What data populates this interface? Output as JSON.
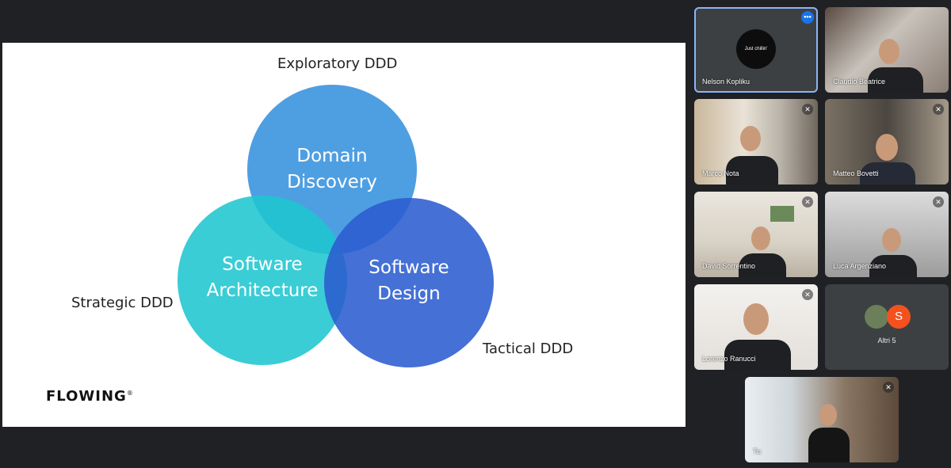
{
  "slide": {
    "top_label": "Exploratory DDD",
    "left_label": "Strategic DDD",
    "right_label": "Tactical DDD",
    "circles": [
      {
        "line1": "Domain",
        "line2": "Discovery",
        "color": "#3f97e0"
      },
      {
        "line1": "Software",
        "line2": "Architecture",
        "color": "#2ec8d0"
      },
      {
        "line1": "Software",
        "line2": "Design",
        "color": "#2f5fd0"
      }
    ],
    "logo": "FLOWING",
    "logo_mark": "®"
  },
  "participants": [
    {
      "name": "Nelson Kopliku",
      "avatar_text": "Just chillin'",
      "active": true
    },
    {
      "name": "Claudio Beatrice"
    },
    {
      "name": "Marco Nota"
    },
    {
      "name": "Matteo Bovetti"
    },
    {
      "name": "David Sorrentino"
    },
    {
      "name": "Luca Argenziano"
    },
    {
      "name": "Lorenzo Ranucci"
    },
    {
      "name": "Altri 5",
      "initial": "S"
    },
    {
      "name": "Tu"
    }
  ],
  "colors": {
    "meet_bg": "#202124",
    "active_outline": "#8ab4f8",
    "more_button": "#1a73e8"
  },
  "icons": {
    "mic_off": "mic-off-icon",
    "more": "more-options-icon"
  }
}
